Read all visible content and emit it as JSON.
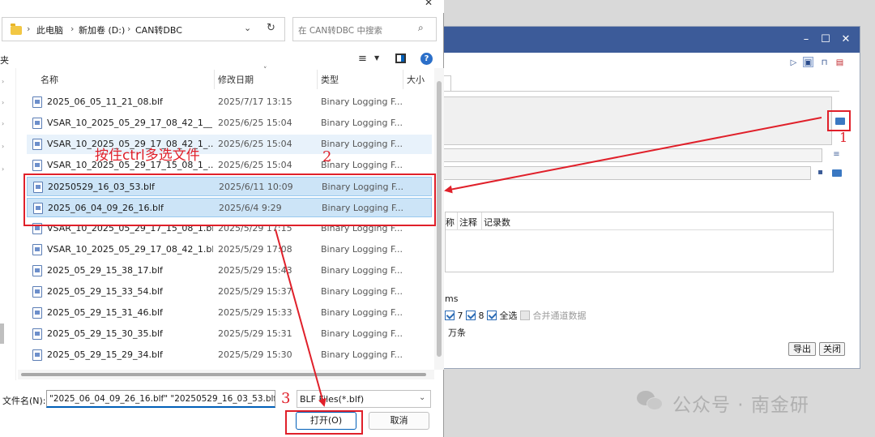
{
  "dialog": {
    "breadcrumb": [
      "此电脑",
      "新加卷 (D:)",
      "CAN转DBC"
    ],
    "search_placeholder": "在 CAN转DBC 中搜索",
    "nav_label_fragment": "夹",
    "columns": {
      "name": "名称",
      "modified": "修改日期",
      "type": "类型",
      "size": "大小"
    },
    "files": [
      {
        "name": "2025_06_05_11_21_08.blf",
        "date": "2025/7/17 13:15",
        "type": "Binary Logging F...",
        "state": "normal"
      },
      {
        "name": "VSAR_10_2025_05_29_17_08_42_1__...",
        "date": "2025/6/25 15:04",
        "type": "Binary Logging F...",
        "state": "normal"
      },
      {
        "name": "VSAR_10_2025_05_29_17_08_42_1_...",
        "date": "2025/6/25 15:04",
        "type": "Binary Logging F...",
        "state": "hover"
      },
      {
        "name": "VSAR_10_2025_05_29_17_15_08_1_...",
        "date": "2025/6/25 15:04",
        "type": "Binary Logging F...",
        "state": "normal"
      },
      {
        "name": "20250529_16_03_53.blf",
        "date": "2025/6/11 10:09",
        "type": "Binary Logging F...",
        "state": "selected"
      },
      {
        "name": "2025_06_04_09_26_16.blf",
        "date": "2025/6/4 9:29",
        "type": "Binary Logging F...",
        "state": "selected"
      },
      {
        "name": "VSAR_10_2025_05_29_17_15_08_1.blf",
        "date": "2025/5/29 17:15",
        "type": "Binary Logging F...",
        "state": "normal"
      },
      {
        "name": "VSAR_10_2025_05_29_17_08_42_1.blf",
        "date": "2025/5/29 17:08",
        "type": "Binary Logging F...",
        "state": "normal"
      },
      {
        "name": "2025_05_29_15_38_17.blf",
        "date": "2025/5/29 15:43",
        "type": "Binary Logging F...",
        "state": "normal"
      },
      {
        "name": "2025_05_29_15_33_54.blf",
        "date": "2025/5/29 15:37",
        "type": "Binary Logging F...",
        "state": "normal"
      },
      {
        "name": "2025_05_29_15_31_46.blf",
        "date": "2025/5/29 15:33",
        "type": "Binary Logging F...",
        "state": "normal"
      },
      {
        "name": "2025_05_29_15_30_35.blf",
        "date": "2025/5/29 15:31",
        "type": "Binary Logging F...",
        "state": "normal"
      },
      {
        "name": "2025_05_29_15_29_34.blf",
        "date": "2025/5/29 15:30",
        "type": "Binary Logging F...",
        "state": "normal"
      }
    ],
    "filename_label": "文件名(N):",
    "filename_value": "\"2025_06_04_09_26_16.blf\" \"20250529_16_03_53.blf\"",
    "filetype_value": "BLF Files(*.blf)",
    "open_label": "打开(O)",
    "cancel_label": "取消"
  },
  "background_window": {
    "table_headers": [
      "称",
      "注释",
      "记录数"
    ],
    "ms_label": "ms",
    "channel_7": "7",
    "channel_8": "8",
    "select_all_label": "全选",
    "merge_label": "合并通道数据",
    "wan_label": "万条",
    "export_label": "导出",
    "close_label": "关闭"
  },
  "annotations": {
    "hint": "按住ctrl多选文件",
    "step1": "1",
    "step2": "2",
    "step3": "3",
    "color": "#e0202a"
  },
  "watermark": {
    "text": "公众号 · 南金研"
  }
}
